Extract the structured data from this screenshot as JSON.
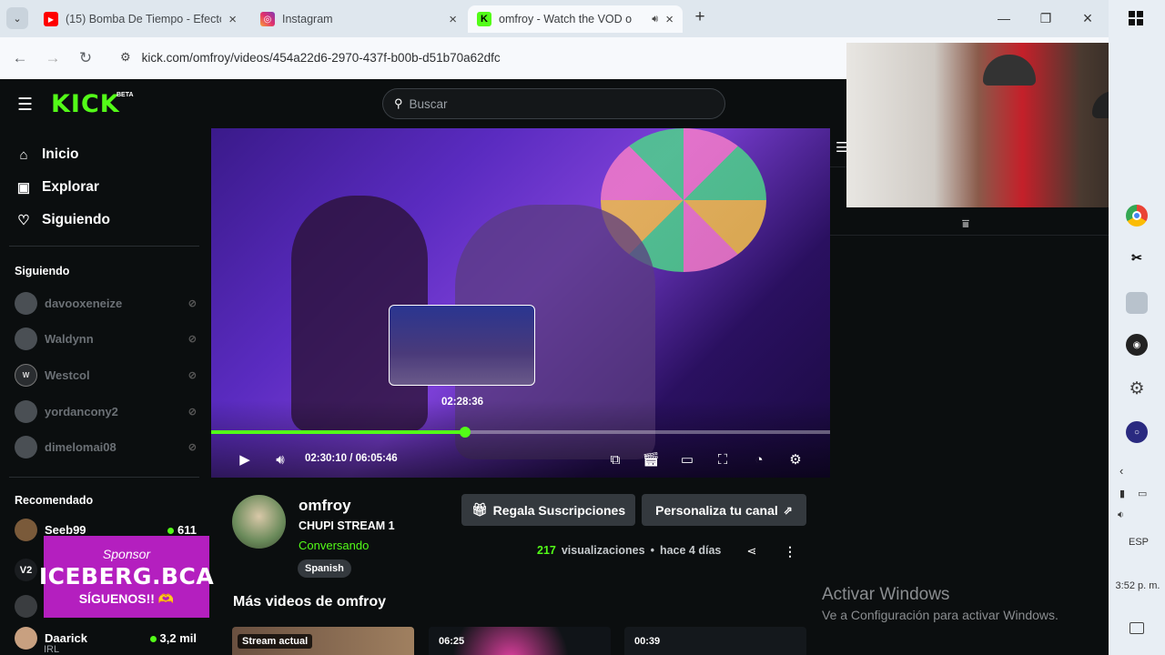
{
  "browser": {
    "tabs": [
      {
        "title": "(15) Bomba De Tiempo - Efecto",
        "icon": "youtube-icon"
      },
      {
        "title": "Instagram",
        "icon": "instagram-icon"
      },
      {
        "title": "omfroy - Watch the VOD o",
        "icon": "kick-icon"
      }
    ],
    "url": "kick.com/omfroy/videos/454a22d6-2970-437f-b00b-d51b70a62dfc"
  },
  "kick": {
    "logo": "KICK",
    "beta": "BETA",
    "search_placeholder": "Buscar",
    "nav": [
      {
        "label": "Inicio"
      },
      {
        "label": "Explorar"
      },
      {
        "label": "Siguiendo"
      }
    ],
    "following_header": "Siguiendo",
    "following": [
      {
        "name": "davooxeneize"
      },
      {
        "name": "Waldynn"
      },
      {
        "name": "Westcol"
      },
      {
        "name": "yordancony2"
      },
      {
        "name": "dimelomai08"
      }
    ],
    "recommended_header": "Recomendado",
    "recommended": [
      {
        "name": "Seeb99",
        "viewers": "611"
      },
      {
        "name": "Daarick",
        "viewers": "3,2 mil",
        "sub": "IRL"
      }
    ],
    "sponsor": {
      "line1": "Sponsor",
      "line2": "ICEBERG.BCA",
      "line3": "SÍGUENOS!! 🫶"
    }
  },
  "player": {
    "preview_time": "02:28:36",
    "current_time": "02:30:10",
    "separator": " / ",
    "duration": "06:05:46",
    "progress_fraction": 0.411
  },
  "channel": {
    "name": "omfroy",
    "stream_title": "CHUPI STREAM 1",
    "category": "Conversando",
    "language": "Spanish",
    "gift_button": "Regala Suscripciones",
    "customize_button": "Personaliza tu canal",
    "views": "217",
    "views_label": "visualizaciones",
    "bullet": "•",
    "age": "hace 4 días"
  },
  "more": {
    "header": "Más videos de omfroy",
    "videos": [
      {
        "label": "Stream actual"
      },
      {
        "label": "06:25"
      },
      {
        "label": "00:39"
      }
    ]
  },
  "windows": {
    "activate_title": "Activar Windows",
    "activate_sub": "Ve a Configuración para activar Windows.",
    "lang": "ESP",
    "time": "3:52 p. m."
  }
}
